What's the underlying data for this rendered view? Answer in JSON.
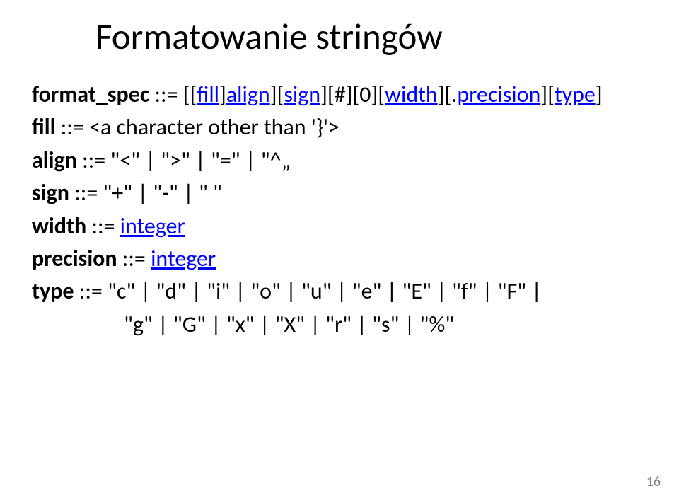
{
  "title": "Formatowanie stringów",
  "rules": {
    "format_spec": {
      "label": "format_spec",
      "def": "::= [[",
      "fill": "fill",
      "close1": "]",
      "align": "align",
      "mid1": "][",
      "sign": "sign",
      "mid2": "][#][0][",
      "width": "width",
      "mid3": "][.",
      "precision": "precision",
      "mid4": "][",
      "type": "type",
      "close2": "]"
    },
    "fill": {
      "label": "fill",
      "def": " ::= <a character other than '}'>"
    },
    "align": {
      "label": "align",
      "def": " ::= \"<\" | \">\" | \"=\" | \"^„"
    },
    "sign": {
      "label": "sign",
      "def": " ::= \"+\" | \"-\" | \" \""
    },
    "width": {
      "label": "width",
      "def": " ::= ",
      "link": "integer"
    },
    "precision": {
      "label": "precision",
      "def": " ::= ",
      "link": "integer"
    },
    "type": {
      "label": "type",
      "def_line1": " ::= \"c\" | \"d\" | \"i\" | \"o\" | \"u\" | \"e\" | \"E\" | \"f\" | \"F\" |",
      "def_line2": "\"g\" | \"G\" | \"x\" | \"X\" | \"r\" | \"s\" | \"%\""
    }
  },
  "page_number": "16"
}
